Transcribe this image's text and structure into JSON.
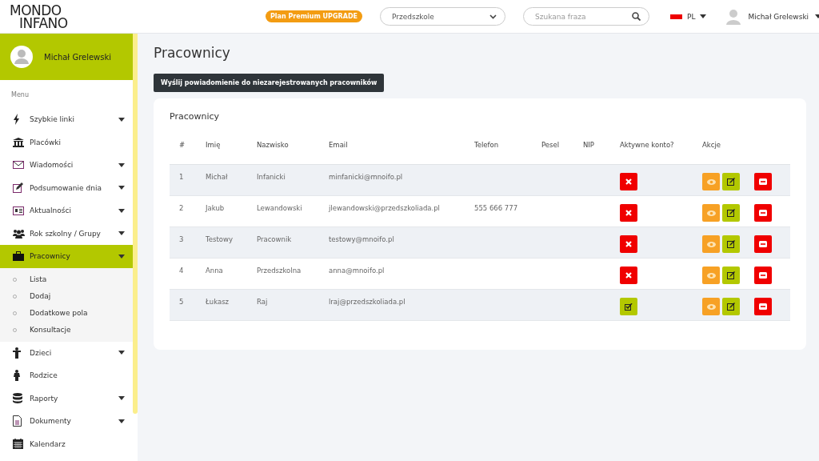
{
  "header": {
    "logo": [
      "MONDO",
      "INFANO"
    ],
    "premium_badge": "Plan Premium UPGRADE",
    "facility_select": {
      "value": "Przedszkole"
    },
    "search": {
      "placeholder": "Szukana fraza"
    },
    "language": "PL",
    "user_name": "Michał Grelewski"
  },
  "sidebar": {
    "profile_name": "Michał Grelewski",
    "menu_label": "Menu",
    "items": [
      {
        "label": "Szybkie linki",
        "dropdown": true,
        "selected": false
      },
      {
        "label": "Placówki",
        "dropdown": false,
        "selected": false
      },
      {
        "label": "Wiadomości",
        "dropdown": true,
        "selected": false
      },
      {
        "label": "Podsumowanie dnia",
        "dropdown": true,
        "selected": false
      },
      {
        "label": "Aktualności",
        "dropdown": true,
        "selected": false
      },
      {
        "label": "Rok szkolny / Grupy",
        "dropdown": true,
        "selected": false
      },
      {
        "label": "Pracownicy",
        "dropdown": true,
        "selected": true,
        "children": [
          {
            "label": "Lista"
          },
          {
            "label": "Dodaj"
          },
          {
            "label": "Dodatkowe pola"
          },
          {
            "label": "Konsultacje"
          }
        ]
      },
      {
        "label": "Dzieci",
        "dropdown": true,
        "selected": false
      },
      {
        "label": "Rodzice",
        "dropdown": false,
        "selected": false
      },
      {
        "label": "Raporty",
        "dropdown": true,
        "selected": false
      },
      {
        "label": "Dokumenty",
        "dropdown": true,
        "selected": false
      },
      {
        "label": "Kalendarz",
        "dropdown": false,
        "selected": false
      }
    ]
  },
  "page": {
    "title": "Pracownicy",
    "notify_button": "Wyślij powiadomienie do niezarejestrowanych pracowników",
    "card": {
      "title": "Pracownicy",
      "table": {
        "columns": [
          "#",
          "Imię",
          "Nazwisko",
          "Email",
          "Telefon",
          "Pesel",
          "NIP",
          "Aktywne konto?",
          "Akcje"
        ],
        "rows": [
          {
            "number": "1",
            "first_name": "Michał",
            "last_name": "Infanicki",
            "email": "minfanicki@mnoifo.pl",
            "phone": "",
            "active": false
          },
          {
            "number": "2",
            "first_name": "Jakub",
            "last_name": "Lewandowski",
            "email": "jlewandowski@przedszkoliada.pl",
            "phone": "555 666 777",
            "active": false
          },
          {
            "number": "3",
            "first_name": "Testowy",
            "last_name": "Pracownik",
            "email": "testowy@mnoifo.pl",
            "phone": "",
            "active": false
          },
          {
            "number": "4",
            "first_name": "Anna",
            "last_name": "Przedszkolna",
            "email": "anna@mnoifo.pl",
            "phone": "",
            "active": false
          },
          {
            "number": "5",
            "first_name": "Łukasz",
            "last_name": "Raj",
            "email": "lraj@przedszkoliada.pl",
            "phone": "",
            "active": true
          }
        ]
      }
    }
  }
}
